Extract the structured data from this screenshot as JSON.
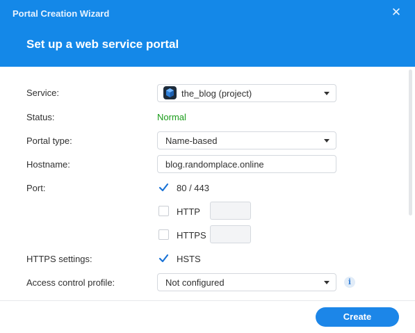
{
  "window": {
    "title": "Portal Creation Wizard",
    "close_label": "✕"
  },
  "page": {
    "heading": "Set up a web service portal"
  },
  "form": {
    "service": {
      "label": "Service:",
      "value": "the_blog (project)",
      "icon": "project-cube-icon"
    },
    "status": {
      "label": "Status:",
      "value": "Normal",
      "color": "#1a9c1a"
    },
    "portal_type": {
      "label": "Portal type:",
      "value": "Name-based"
    },
    "hostname": {
      "label": "Hostname:",
      "value": "blog.randomplace.online"
    },
    "port": {
      "label": "Port:",
      "options": [
        {
          "label": "80 / 443",
          "checked": true
        },
        {
          "label": "HTTP",
          "checked": false,
          "value": ""
        },
        {
          "label": "HTTPS",
          "checked": false,
          "value": ""
        }
      ]
    },
    "https_settings": {
      "label": "HTTPS settings:",
      "option": {
        "label": "HSTS",
        "checked": true
      }
    },
    "access_control": {
      "label": "Access control profile:",
      "value": "Not configured",
      "info_icon": "i"
    }
  },
  "footer": {
    "create_label": "Create"
  },
  "colors": {
    "header": "#1488e8",
    "accent": "#1c86e8",
    "check": "#1a73d6"
  }
}
